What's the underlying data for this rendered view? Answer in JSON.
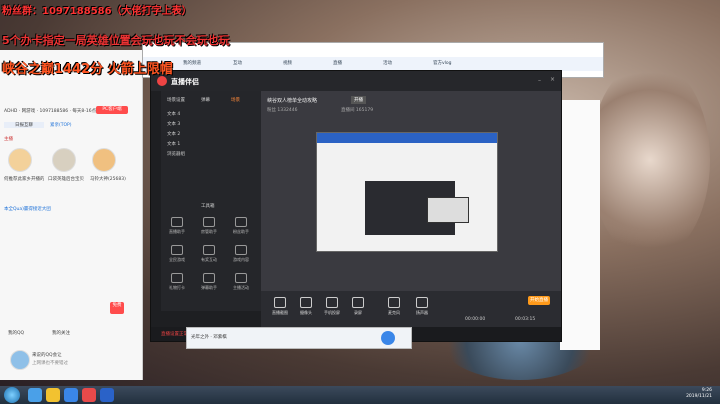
{
  "overlay": {
    "line1": "粉丝群：1097188586（大佬打字上表）",
    "line2": "5个办卡指定一局英雄位置会玩也玩不会玩也玩",
    "line3": "峡谷之巅1442分  火箭上限帽"
  },
  "qq": {
    "header_line": "ADHD · 网游戏 · 1097188586 · 每天8-16点直播",
    "search_tab": "日报互聊",
    "tab2": "紧亲(TOP)",
    "label_anchor": "主播",
    "caption1": "何推荐此家乡开播的",
    "caption2": "口袋英雄后台宝贝",
    "caption3": "马铃大神(25683)",
    "promo": "本全Qua)赢得接近大团",
    "pc_button": "PC客户端",
    "free_button": "免费",
    "footer_name": "来说的QQ会让",
    "footer_sub": "上网课也不要错过",
    "footer_label": "我的关注",
    "footer_label2": "我的QQ"
  },
  "white_app": {
    "tabs": [
      "我的频道",
      "互动",
      "视频",
      "直播",
      "活动",
      "官方vlog"
    ]
  },
  "dark_win": {
    "brand": "直播伴侣",
    "sidebar_tabs": [
      "场景设置",
      "弹幕",
      "场景"
    ],
    "scenes": [
      "文本 4",
      "文本 3",
      "文本 2",
      "文本 1",
      "浏览器组"
    ],
    "tools_title": "工具箱",
    "tools": [
      "直播助手",
      "房管助手",
      "粉丝助手",
      "全民游戏",
      "有奖互动",
      "游戏内容",
      "礼物打卡",
      "弹幕助手",
      "主播活动"
    ],
    "preview_title": "峡谷双人榜单全动攻略",
    "preview_badge": "开播",
    "stats": [
      "粉丝 1332446",
      "直播间 165179"
    ],
    "bottom_tools": [
      "直播截图",
      "摄像头",
      "手机投屏",
      "录屏",
      "麦克风",
      "扬声器"
    ],
    "live_button": "开始直播",
    "status_text": "直播设置正常 · 检测到您有大主播任务组，请立即前往 系统检测",
    "timer1": "00:00:00",
    "timer2": "00:03:15"
  },
  "music": {
    "title": "光年之外 · 邓紫棋"
  },
  "taskbar": {
    "time": "9:26",
    "date": "2019/11/21"
  }
}
